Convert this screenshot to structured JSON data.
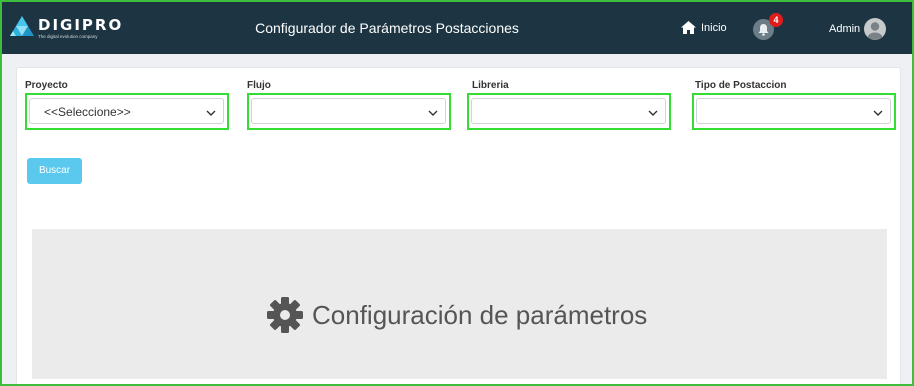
{
  "header": {
    "logo_text": "DIGIPRO",
    "logo_tagline": "The digital evolution company",
    "title": "Configurador de Parámetros Postacciones",
    "inicio_label": "Inicio",
    "notifications_count": "4",
    "user_label": "Admin"
  },
  "filters": {
    "proyecto": {
      "label": "Proyecto",
      "value": "<<Seleccione>>"
    },
    "flujo": {
      "label": "Flujo",
      "value": ""
    },
    "libreria": {
      "label": "Libreria",
      "value": ""
    },
    "tipo": {
      "label": "Tipo de Postaccion",
      "value": ""
    }
  },
  "buscar_label": "Buscar",
  "config_title": "Configuración de parámetros",
  "colors": {
    "topbar": "#1d3543",
    "accent_button": "#5bc8ee",
    "highlight": "#33dd33",
    "badge": "#e01b1b"
  },
  "icons": [
    "home-icon",
    "bell-icon",
    "user-avatar-icon",
    "chevron-down-icon",
    "gear-icon"
  ]
}
